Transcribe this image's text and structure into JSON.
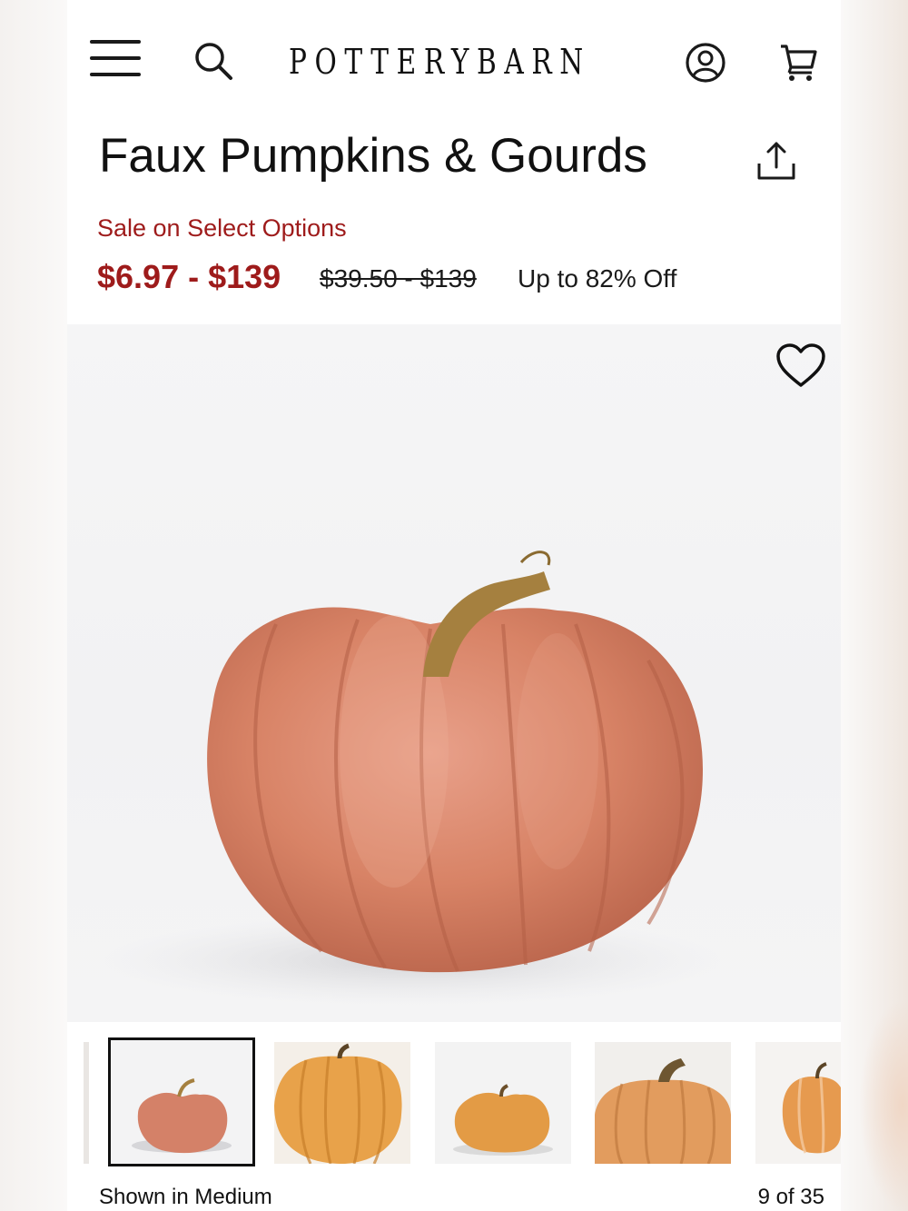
{
  "header": {
    "brand": "POTTERYBARN",
    "icons": [
      "menu-icon",
      "search-icon",
      "account-icon",
      "cart-icon"
    ]
  },
  "product": {
    "title": "Faux Pumpkins & Gourds",
    "sale_label": "Sale on Select Options",
    "sale_price": "$6.97 - $139",
    "original_price": "$39.50 - $139",
    "discount": "Up to 82% Off"
  },
  "gallery": {
    "caption": "Shown in Medium",
    "counter": "9 of 35",
    "thumbnail_count": 5,
    "selected_index": 0
  },
  "colors": {
    "sale_red": "#9e1b1b",
    "text": "#1a1a1a",
    "pumpkin_pink": "#d9856a",
    "pumpkin_orange": "#e59b3e"
  }
}
